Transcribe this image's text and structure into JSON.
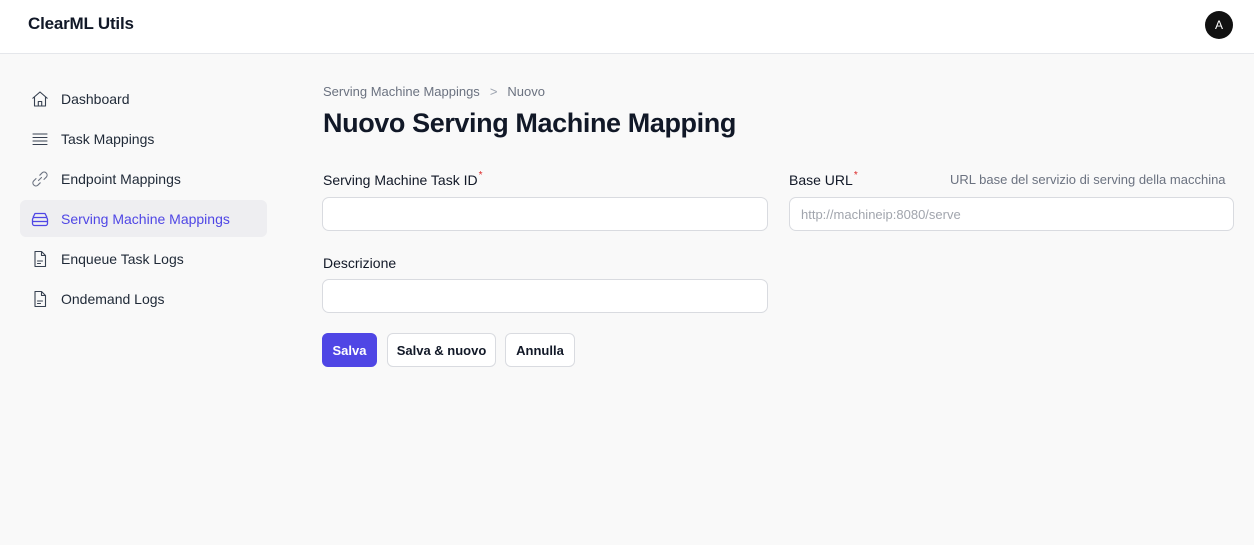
{
  "app": {
    "title": "ClearML Utils",
    "avatar_initial": "A"
  },
  "sidebar": {
    "items": [
      {
        "label": "Dashboard",
        "icon": "home-icon"
      },
      {
        "label": "Task Mappings",
        "icon": "list-icon"
      },
      {
        "label": "Endpoint Mappings",
        "icon": "link-icon"
      },
      {
        "label": "Serving Machine Mappings",
        "icon": "server-icon",
        "active": true
      },
      {
        "label": "Enqueue Task Logs",
        "icon": "document-icon"
      },
      {
        "label": "Ondemand Logs",
        "icon": "document-icon"
      }
    ]
  },
  "breadcrumb": {
    "parent": "Serving Machine Mappings",
    "separator": ">",
    "current": "Nuovo"
  },
  "page": {
    "title": "Nuovo Serving Machine Mapping"
  },
  "form": {
    "task_id": {
      "label": "Serving Machine Task ID",
      "required_mark": "*",
      "value": "",
      "placeholder": ""
    },
    "base_url": {
      "label": "Base URL",
      "required_mark": "*",
      "hint": "URL base del servizio di serving della macchina",
      "value": "",
      "placeholder": "http://machineip:8080/serve"
    },
    "description": {
      "label": "Descrizione",
      "value": "",
      "placeholder": ""
    }
  },
  "actions": {
    "save": "Salva",
    "save_new": "Salva & nuovo",
    "cancel": "Annulla"
  },
  "colors": {
    "accent": "#4f46e5",
    "required": "#dc2626",
    "active_bg": "#eeeef1"
  }
}
